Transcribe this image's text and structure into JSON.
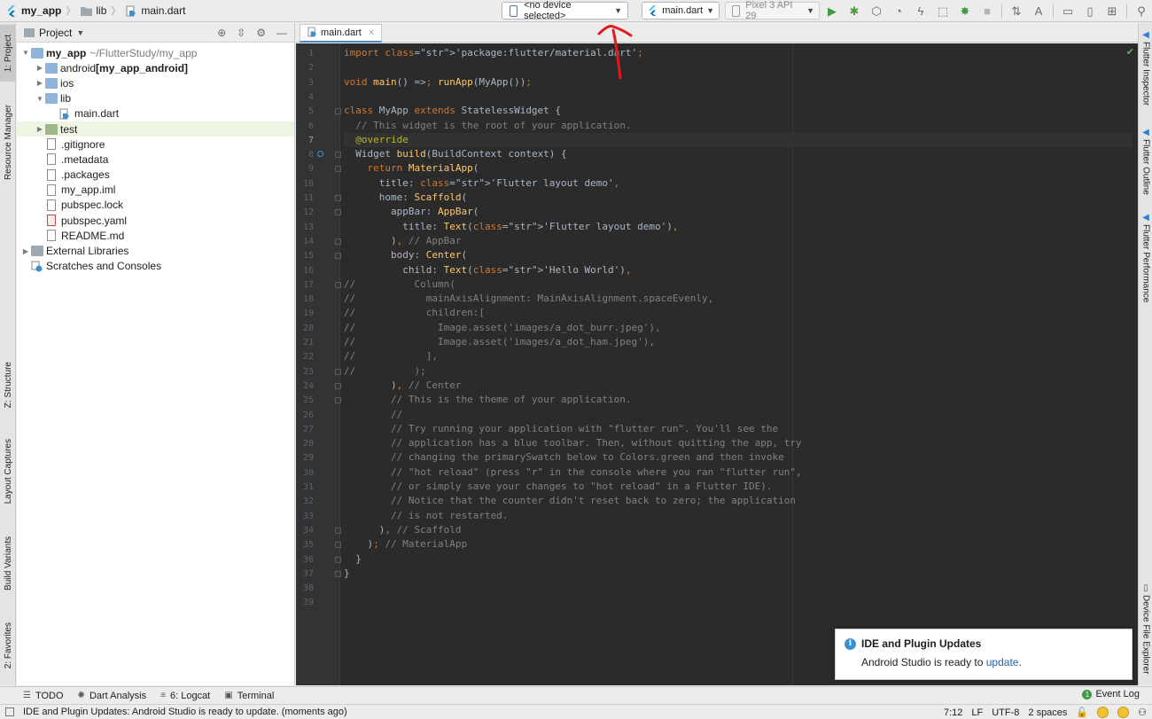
{
  "breadcrumbs": [
    {
      "label": "my_app",
      "icon": "flutter-icon"
    },
    {
      "label": "lib",
      "icon": "folder-icon"
    },
    {
      "label": "main.dart",
      "icon": "dart-file-icon"
    }
  ],
  "toolbar": {
    "device_selector": "<no device selected>",
    "run_config": "main.dart",
    "avd": "Pixel 3 API 29"
  },
  "left_tool_windows": [
    "1: Project",
    "Resource Manager",
    "Z: Structure",
    "Layout Captures",
    "Build Variants",
    "2: Favorites"
  ],
  "right_tool_windows": [
    "Flutter Inspector",
    "Flutter Outline",
    "Flutter Performance",
    "Device File Explorer"
  ],
  "project_panel": {
    "title": "Project",
    "tree": [
      {
        "label": "my_app",
        "suffix": "~/FlutterStudy/my_app",
        "bold": true,
        "indent": 0,
        "expanded": true,
        "icon": "project-folder-icon"
      },
      {
        "label": "android",
        "suffix": "[my_app_android]",
        "bold": false,
        "indent": 1,
        "expanded": false,
        "icon": "folder-icon"
      },
      {
        "label": "ios",
        "suffix": "",
        "indent": 1,
        "expanded": false,
        "icon": "folder-icon"
      },
      {
        "label": "lib",
        "suffix": "",
        "indent": 1,
        "expanded": true,
        "icon": "folder-icon"
      },
      {
        "label": "main.dart",
        "suffix": "",
        "indent": 2,
        "icon": "dart-file-icon"
      },
      {
        "label": "test",
        "suffix": "",
        "indent": 1,
        "expanded": false,
        "icon": "test-folder-icon",
        "highlighted": true
      },
      {
        "label": ".gitignore",
        "suffix": "",
        "indent": 1,
        "icon": "text-file-icon"
      },
      {
        "label": ".metadata",
        "suffix": "",
        "indent": 1,
        "icon": "text-file-icon"
      },
      {
        "label": ".packages",
        "suffix": "",
        "indent": 1,
        "icon": "text-file-icon"
      },
      {
        "label": "my_app.iml",
        "suffix": "",
        "indent": 1,
        "icon": "iml-file-icon"
      },
      {
        "label": "pubspec.lock",
        "suffix": "",
        "indent": 1,
        "icon": "text-file-icon"
      },
      {
        "label": "pubspec.yaml",
        "suffix": "",
        "indent": 1,
        "icon": "yaml-file-icon"
      },
      {
        "label": "README.md",
        "suffix": "",
        "indent": 1,
        "icon": "markdown-file-icon"
      },
      {
        "label": "External Libraries",
        "suffix": "",
        "indent": 0,
        "expanded": false,
        "icon": "library-icon"
      },
      {
        "label": "Scratches and Consoles",
        "suffix": "",
        "indent": 0,
        "icon": "scratches-icon"
      }
    ]
  },
  "editor": {
    "tab": "main.dart",
    "current_line": 7,
    "lines": [
      "import 'package:flutter/material.dart';",
      "",
      "void main() => runApp(MyApp());",
      "",
      "class MyApp extends StatelessWidget {",
      "  // This widget is the root of your application.",
      "  @override",
      "  Widget build(BuildContext context) {",
      "    return MaterialApp(",
      "      title: 'Flutter layout demo',",
      "      home: Scaffold(",
      "        appBar: AppBar(",
      "          title: Text('Flutter layout demo'),",
      "        ), // AppBar",
      "        body: Center(",
      "          child: Text('Hello World'),",
      "//          Column(",
      "//            mainAxisAlignment: MainAxisAlignment.spaceEvenly,",
      "//            children:[",
      "//              Image.asset('images/a_dot_burr.jpeg'),",
      "//              Image.asset('images/a_dot_ham.jpeg'),",
      "//            ],",
      "//          );",
      "        ), // Center",
      "        // This is the theme of your application.",
      "        //",
      "        // Try running your application with \"flutter run\". You'll see the",
      "        // application has a blue toolbar. Then, without quitting the app, try",
      "        // changing the primarySwatch below to Colors.green and then invoke",
      "        // \"hot reload\" (press \"r\" in the console where you ran \"flutter run\",",
      "        // or simply save your changes to \"hot reload\" in a Flutter IDE).",
      "        // Notice that the counter didn't reset back to zero; the application",
      "        // is not restarted.",
      "      ), // Scaffold",
      "    ); // MaterialApp",
      "  }",
      "}",
      "",
      ""
    ]
  },
  "notification": {
    "title": "IDE and Plugin Updates",
    "body_prefix": "Android Studio is ready to ",
    "link": "update",
    "body_suffix": "."
  },
  "bottom_tabs": [
    {
      "label": "TODO",
      "icon": "list-icon"
    },
    {
      "label": "Dart Analysis",
      "icon": "dart-analysis-icon"
    },
    {
      "label": "6: Logcat",
      "icon": "logcat-icon"
    },
    {
      "label": "Terminal",
      "icon": "terminal-icon"
    }
  ],
  "event_log": "Event Log",
  "status_bar": {
    "message": "IDE and Plugin Updates: Android Studio is ready to update. (moments ago)",
    "position": "7:12",
    "line_sep": "LF",
    "encoding": "UTF-8",
    "indent": "2 spaces"
  },
  "colors": {
    "editor_bg": "#2b2b2b",
    "keyword": "#cc7832",
    "string": "#6a8759",
    "function": "#ffc66d",
    "comment": "#808080",
    "annotation_arrow": "#e01b1b"
  }
}
